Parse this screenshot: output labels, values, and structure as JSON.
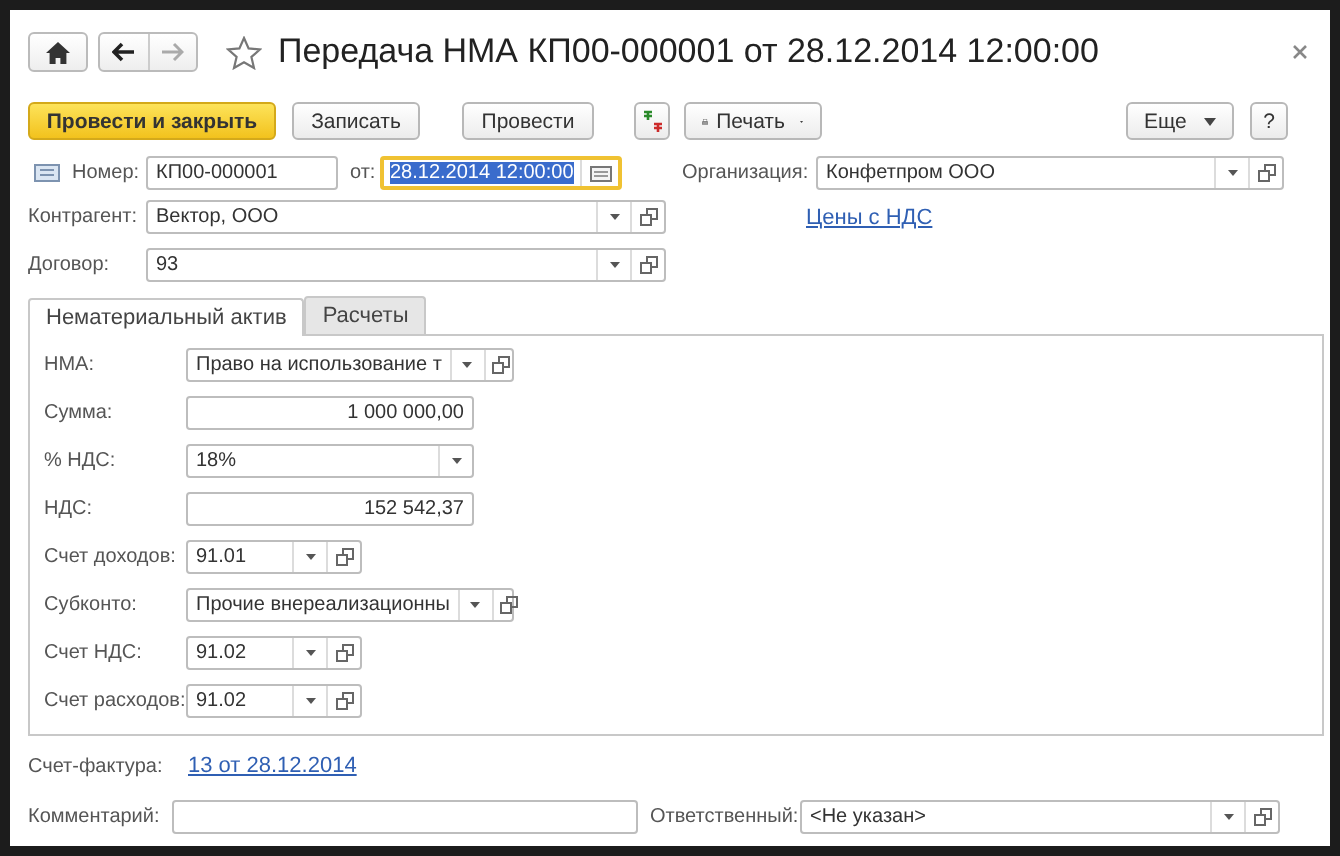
{
  "window": {
    "title": "Передача НМА КП00-000001 от 28.12.2014 12:00:00"
  },
  "toolbar": {
    "buttons": [
      {
        "label": "Провести и закрыть",
        "kind": "primary"
      },
      {
        "label": "Записать",
        "kind": "plain"
      },
      {
        "label": "Провести",
        "kind": "plain"
      },
      {
        "kind": "postings"
      },
      {
        "label": "Печать",
        "kind": "print"
      }
    ],
    "right_buttons": [
      {
        "label": "Еще",
        "kind": "menu"
      },
      {
        "label": "?",
        "kind": "plain"
      }
    ]
  },
  "header": {
    "number": {
      "label": "Номер:",
      "value": "КП00-000001",
      "focused": false,
      "dropdown": false,
      "open": false
    },
    "date": {
      "label": "от:",
      "value": "28.12.2014 12:00:00",
      "focused": true,
      "calendar": true
    },
    "organization": {
      "label": "Организация:",
      "value": "Конфетпром ООО",
      "focused": false,
      "dropdown": true,
      "open": true
    },
    "counterparty": {
      "label": "Контрагент:",
      "value": "Вектор, ООО",
      "focused": false,
      "dropdown": true,
      "open": true
    },
    "prices_link": "Цены с НДС",
    "contract": {
      "label": "Договор:",
      "value": "93",
      "focused": false,
      "dropdown": true,
      "open": true
    }
  },
  "tabs": [
    {
      "label": "Нематериальный актив",
      "selected": true
    },
    {
      "label": "Расчеты",
      "selected": false
    }
  ],
  "asset_fields": [
    {
      "label": "НМА:",
      "value": "Право на использование т",
      "kind": "reference",
      "focused": false,
      "dropdown": true,
      "open": true
    },
    {
      "label": "Сумма:",
      "value": "1 000 000,00",
      "kind": "amount",
      "focused": false,
      "dropdown": false,
      "open": false
    },
    {
      "label": "% НДС:",
      "value": "18%",
      "kind": "choice",
      "focused": false,
      "dropdown": true,
      "open": false
    },
    {
      "label": "НДС:",
      "value": "152 542,37",
      "kind": "amount",
      "focused": false,
      "dropdown": false,
      "open": false
    },
    {
      "label": "Счет доходов:",
      "value": "91.01",
      "kind": "account",
      "focused": false,
      "dropdown": true,
      "open": true
    },
    {
      "label": "Субконто:",
      "value": "Прочие внереализационны",
      "kind": "reference",
      "focused": false,
      "dropdown": true,
      "open": true
    },
    {
      "label": "Счет НДС:",
      "value": "91.02",
      "kind": "account",
      "focused": false,
      "dropdown": true,
      "open": true
    },
    {
      "label": "Счет расходов:",
      "value": "91.02",
      "kind": "account",
      "focused": false,
      "dropdown": true,
      "open": true
    }
  ],
  "invoice": {
    "label": "Счет-фактура:",
    "link": "13 от 28.12.2014"
  },
  "comment": {
    "label": "Комментарий:"
  },
  "responsible": {
    "label": "Ответственный:",
    "value": "<Не указан>",
    "focused": false,
    "dropdown": true,
    "open": true
  }
}
